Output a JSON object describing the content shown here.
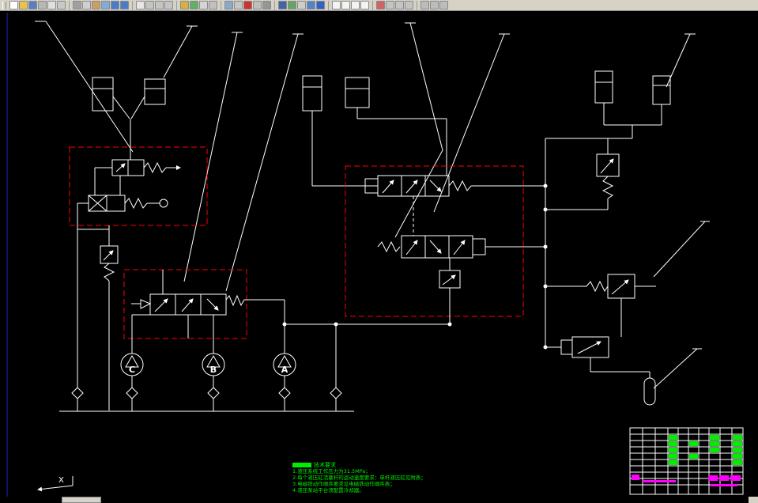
{
  "colors": {
    "line": "#ffffff",
    "red": "#ff0000",
    "green": "#00ee00",
    "magenta": "#ff00ff",
    "blue": "#2222bb",
    "toolbar": "#d6d2c6"
  },
  "toolbar": {
    "groups": [
      [
        {
          "name": "new-file",
          "color": "#ffffff"
        },
        {
          "name": "open-file",
          "color": "#e8c44a"
        },
        {
          "name": "save-file",
          "color": "#5a7ec0"
        },
        {
          "name": "plot",
          "color": "#b8b8b8"
        },
        {
          "name": "plot-preview",
          "color": "#e0e0e0"
        },
        {
          "name": "publish",
          "color": "#c8c8c8"
        }
      ],
      [
        {
          "name": "cut",
          "color": "#a0a0a0"
        },
        {
          "name": "copy",
          "color": "#d0d0d0"
        },
        {
          "name": "paste",
          "color": "#c8a060"
        },
        {
          "name": "match-properties",
          "color": "#86aad6"
        },
        {
          "name": "undo",
          "color": "#4a7ac8"
        },
        {
          "name": "redo",
          "color": "#4a7ac8"
        }
      ],
      [
        {
          "name": "pan",
          "color": "#e6e6e6"
        },
        {
          "name": "zoom-realtime",
          "color": "#c4c4c4"
        },
        {
          "name": "zoom-window",
          "color": "#c4c4c4"
        },
        {
          "name": "zoom-previous",
          "color": "#c4c4c4"
        }
      ],
      [
        {
          "name": "distance",
          "color": "#d8b040"
        },
        {
          "name": "area",
          "color": "#62b062"
        },
        {
          "name": "list",
          "color": "#d4d4d4"
        },
        {
          "name": "locate-point",
          "color": "#c0c0c0"
        }
      ],
      [
        {
          "name": "layers",
          "color": "#88a8cc"
        },
        {
          "name": "layer-states",
          "color": "#c6c6c6"
        },
        {
          "name": "color-control",
          "color": "#cc3434"
        },
        {
          "name": "linetype",
          "color": "#bebebe"
        },
        {
          "name": "lineweight",
          "color": "#969696"
        }
      ],
      [
        {
          "name": "text-style",
          "color": "#4464a8"
        },
        {
          "name": "dim-style",
          "color": "#64a464"
        },
        {
          "name": "table-style",
          "color": "#cccccc"
        },
        {
          "name": "properties",
          "color": "#5484c8"
        },
        {
          "name": "help",
          "color": "#3462c4"
        }
      ],
      [
        {
          "name": "line-tool",
          "color": "#f4f4f4"
        },
        {
          "name": "polyline-tool",
          "color": "#f4f4f4"
        },
        {
          "name": "circle-tool",
          "color": "#f4f4f4"
        },
        {
          "name": "arc-tool",
          "color": "#f4f4f4"
        }
      ],
      [
        {
          "name": "erase",
          "color": "#d06464"
        },
        {
          "name": "move",
          "color": "#c4c4c4"
        },
        {
          "name": "rotate",
          "color": "#c4c4c4"
        },
        {
          "name": "scale",
          "color": "#c4c4c4"
        }
      ],
      [
        {
          "name": "model-space",
          "color": "#bcbcbc"
        },
        {
          "name": "object-snap",
          "color": "#bcbcbc"
        },
        {
          "name": "grid-toggle",
          "color": "#bcbcbc"
        }
      ]
    ]
  },
  "drawing": {
    "pumps": [
      "C",
      "B",
      "A"
    ],
    "ucs_label": "X",
    "tech_notes": {
      "title": "技术要求",
      "lines": [
        "1.液压系统工作压力为31.5MPa；",
        "2.每个液压缸活塞杆的运动速度要求：单杆液压缸见附表；",
        "3.电磁铁动作顺序要求见电磁铁动作顺序表；",
        "4.液压泵站平台须配置冷却器。"
      ]
    }
  }
}
